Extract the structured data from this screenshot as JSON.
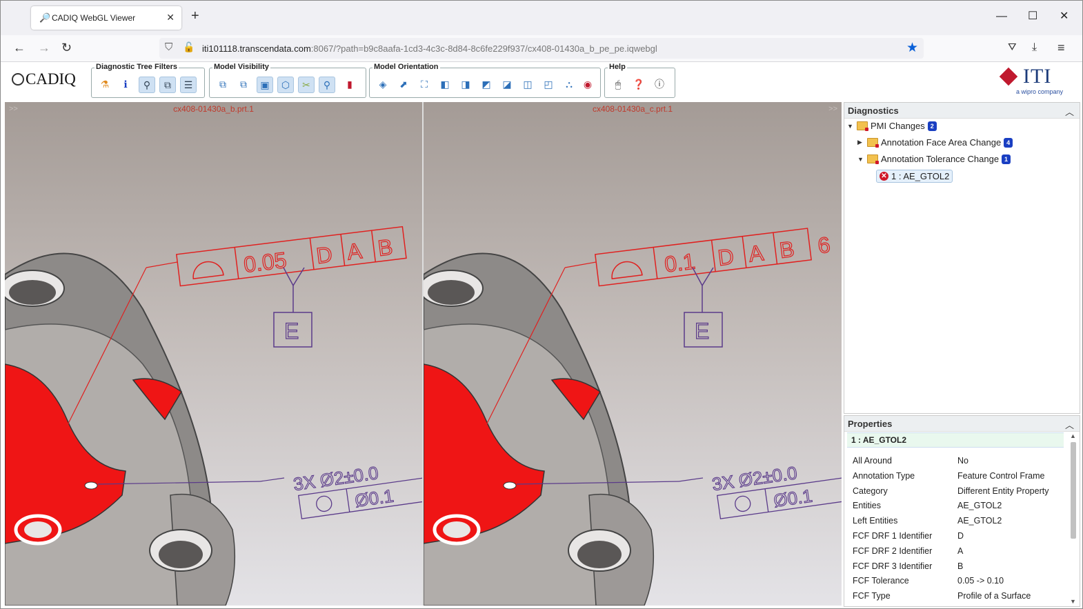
{
  "browser": {
    "tab_title": "CADIQ WebGL Viewer",
    "url_host": "iti101118.transcendata.com",
    "url_rest": ":8067/?path=b9c8aafa-1cd3-4c3c-8d84-8c6fe229f937/cx408-01430a_b_pe_pe.iqwebgl"
  },
  "toolbar": {
    "logo": "CADIQ",
    "groups": {
      "diagnostic_tree_filters": "Diagnostic Tree Filters",
      "model_visibility": "Model Visibility",
      "model_orientation": "Model Orientation",
      "help": "Help"
    },
    "brand": {
      "name": "ITI",
      "tagline": "a wipro company"
    }
  },
  "viewports": {
    "left": {
      "title": "cx408-01430a_b.prt.1",
      "fcf_tolerance": "0.05",
      "fcf_refs": [
        "D",
        "A",
        "B"
      ],
      "datum": "E",
      "callout_line1": "3X Ø2±0.0",
      "callout_line2": "Ø0.1"
    },
    "right": {
      "title": "cx408-01430a_c.prt.1",
      "fcf_tolerance": "0.1",
      "fcf_refs": [
        "D",
        "A",
        "B"
      ],
      "datum": "E",
      "callout_line1": "3X Ø2±0.0",
      "callout_line2": "Ø0.1",
      "trailing": "6"
    }
  },
  "diagnostics": {
    "title": "Diagnostics",
    "root": {
      "label": "PMI Changes",
      "count": "2"
    },
    "children": [
      {
        "label": "Annotation Face Area Change",
        "count": "4"
      },
      {
        "label": "Annotation Tolerance Change",
        "count": "1"
      }
    ],
    "selected_item": "1 : AE_GTOL2"
  },
  "properties": {
    "title": "Properties",
    "selected": "1 : AE_GTOL2",
    "rows": [
      {
        "key": "All Around",
        "value": "No"
      },
      {
        "key": "Annotation Type",
        "value": "Feature Control Frame"
      },
      {
        "key": "Category",
        "value": "Different Entity Property"
      },
      {
        "key": "Entities",
        "value": "AE_GTOL2"
      },
      {
        "key": "Left Entities",
        "value": "AE_GTOL2"
      },
      {
        "key": "FCF DRF 1 Identifier",
        "value": "D"
      },
      {
        "key": "FCF DRF 2 Identifier",
        "value": "A"
      },
      {
        "key": "FCF DRF 3 Identifier",
        "value": "B"
      },
      {
        "key": "FCF Tolerance",
        "value": "0.05 -> 0.10"
      },
      {
        "key": "FCF Type",
        "value": "Profile of a Surface"
      }
    ]
  }
}
